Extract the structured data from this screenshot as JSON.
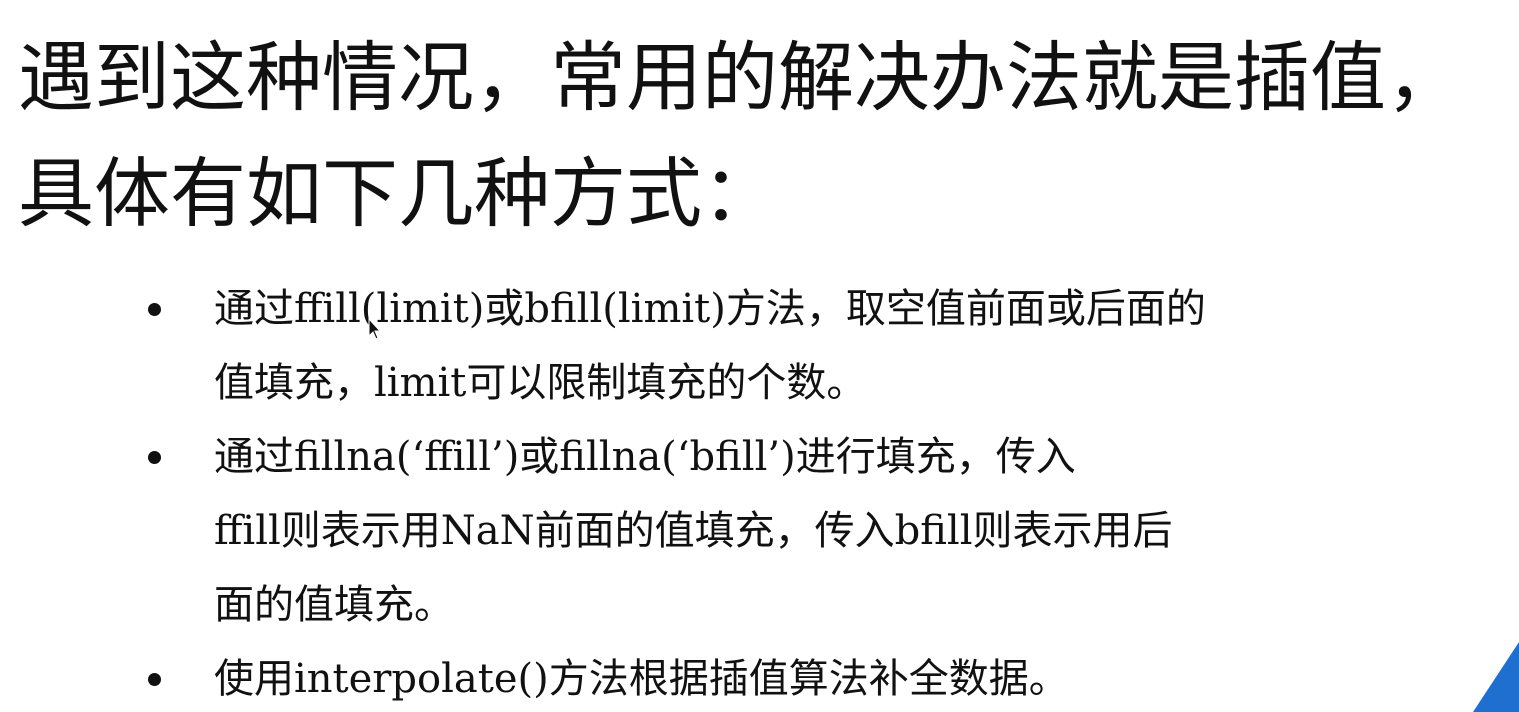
{
  "heading": {
    "lines": [
      "遇到这种情况，常用的解决办法就是插值，",
      "具体有如下几种方式："
    ]
  },
  "bullets": [
    {
      "lines": [
        "通过ffill(limit)或bfill(limit)方法，取空值前面或后面的",
        "值填充，limit可以限制填充的个数。"
      ]
    },
    {
      "lines": [
        "通过fillna(‘ffill’)或fillna(‘bfill’)进行填充，传入",
        "ffill则表示用NaN前面的值填充，传入bfill则表示用后",
        "面的值填充。"
      ]
    },
    {
      "lines": [
        "使用interpolate()方法根据插值算法补全数据。"
      ]
    }
  ],
  "icons": {
    "cursor": "mouse-pointer-icon",
    "decoration": "blue-corner-triangle"
  },
  "colors": {
    "text": "#111111",
    "background": "#ffffff",
    "accent": "#1f6fd1"
  }
}
